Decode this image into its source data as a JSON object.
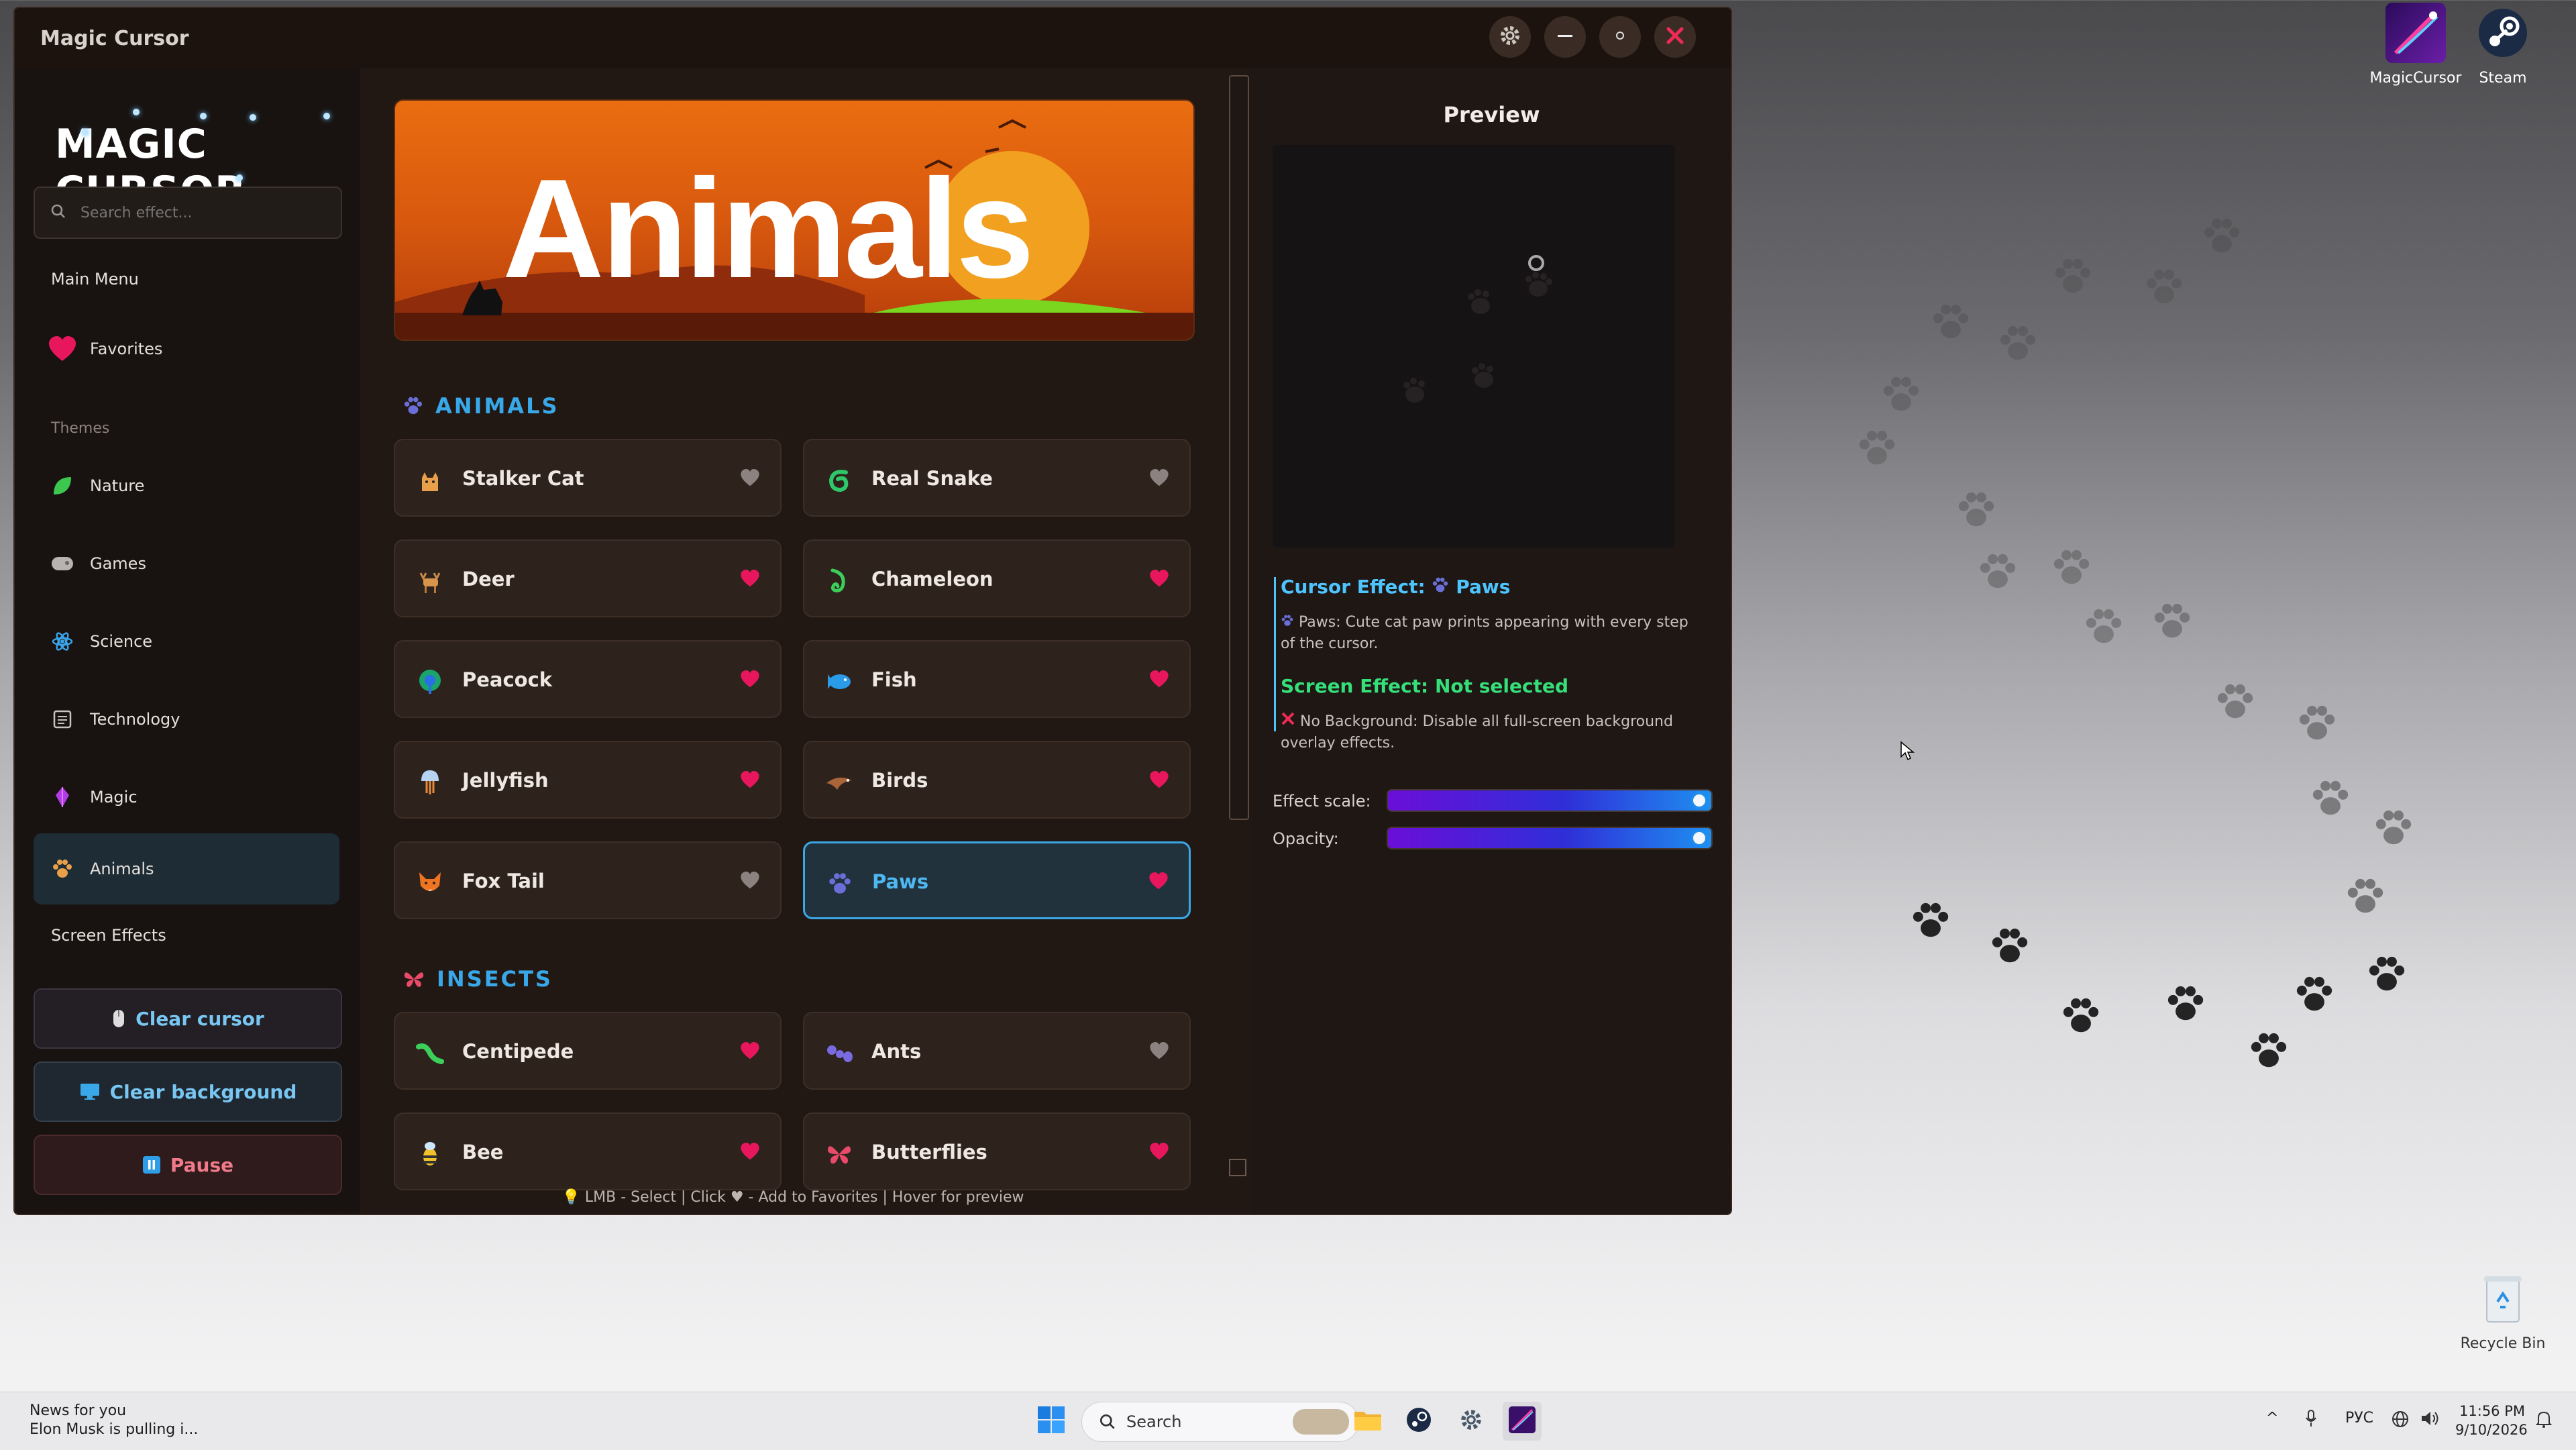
{
  "window": {
    "title": "Magic Cursor"
  },
  "titlebar_icons": {
    "settings": "gear-icon",
    "minimize": "minimize-icon",
    "maximize": "maximize-icon",
    "close": "close-icon"
  },
  "sidebar": {
    "logo": "MAGIC CURSOR",
    "search_placeholder": "Search effect...",
    "main_menu": "Main Menu",
    "favorites": "Favorites",
    "themes_label": "Themes",
    "themes": [
      {
        "label": "Nature",
        "icon": "leaf-icon"
      },
      {
        "label": "Games",
        "icon": "gamepad-icon"
      },
      {
        "label": "Science",
        "icon": "atom-icon"
      },
      {
        "label": "Technology",
        "icon": "chip-icon"
      },
      {
        "label": "Magic",
        "icon": "crystal-icon"
      },
      {
        "label": "Animals",
        "icon": "paw-icon",
        "active": true
      }
    ],
    "screen_effects": "Screen Effects",
    "buttons": {
      "clear_cursor": "Clear cursor",
      "clear_background": "Clear background",
      "pause": "Pause"
    }
  },
  "main": {
    "banner_text": "Animals",
    "sections": [
      {
        "title": "ANIMALS",
        "items": [
          {
            "label": "Stalker Cat",
            "favorite": false
          },
          {
            "label": "Real Snake",
            "favorite": false
          },
          {
            "label": "Deer",
            "favorite": true
          },
          {
            "label": "Chameleon",
            "favorite": true
          },
          {
            "label": "Peacock",
            "favorite": true
          },
          {
            "label": "Fish",
            "favorite": true
          },
          {
            "label": "Jellyfish",
            "favorite": true
          },
          {
            "label": "Birds",
            "favorite": true
          },
          {
            "label": "Fox Tail",
            "favorite": false
          },
          {
            "label": "Paws",
            "favorite": true,
            "selected": true
          }
        ]
      },
      {
        "title": "INSECTS",
        "items": [
          {
            "label": "Centipede",
            "favorite": true
          },
          {
            "label": "Ants",
            "favorite": false
          },
          {
            "label": "Bee",
            "favorite": true
          },
          {
            "label": "Butterflies",
            "favorite": true
          }
        ]
      }
    ],
    "hint": "LMB - Select | Click ♥ - Add to Favorites | Hover for preview"
  },
  "preview": {
    "title": "Preview",
    "cursor_effect_label": "Cursor Effect:",
    "cursor_effect_value": "Paws",
    "cursor_effect_desc": "Paws: Cute cat paw prints appearing with every step of the cursor.",
    "screen_effect_label": "Screen Effect: Not selected",
    "screen_effect_desc": "No Background: Disable all full-screen background overlay effects.",
    "sliders": [
      {
        "label": "Effect scale:",
        "value": 1.0
      },
      {
        "label": "Opacity:",
        "value": 1.0
      }
    ]
  },
  "desktop": {
    "icons": [
      {
        "label": "MagicCursor"
      },
      {
        "label": "Steam"
      },
      {
        "label": "Recycle Bin"
      }
    ]
  },
  "taskbar": {
    "news_title": "News for you",
    "news_text": "Elon Musk is pulling i...",
    "search": "Search",
    "lang": "РУС",
    "time": "11:56 PM",
    "date": "9/10/2026"
  },
  "colors": {
    "accent": "#3aa8e8",
    "heart": "#e8175d",
    "heart_off": "#8c8380",
    "window_bg": "#1b1412"
  }
}
